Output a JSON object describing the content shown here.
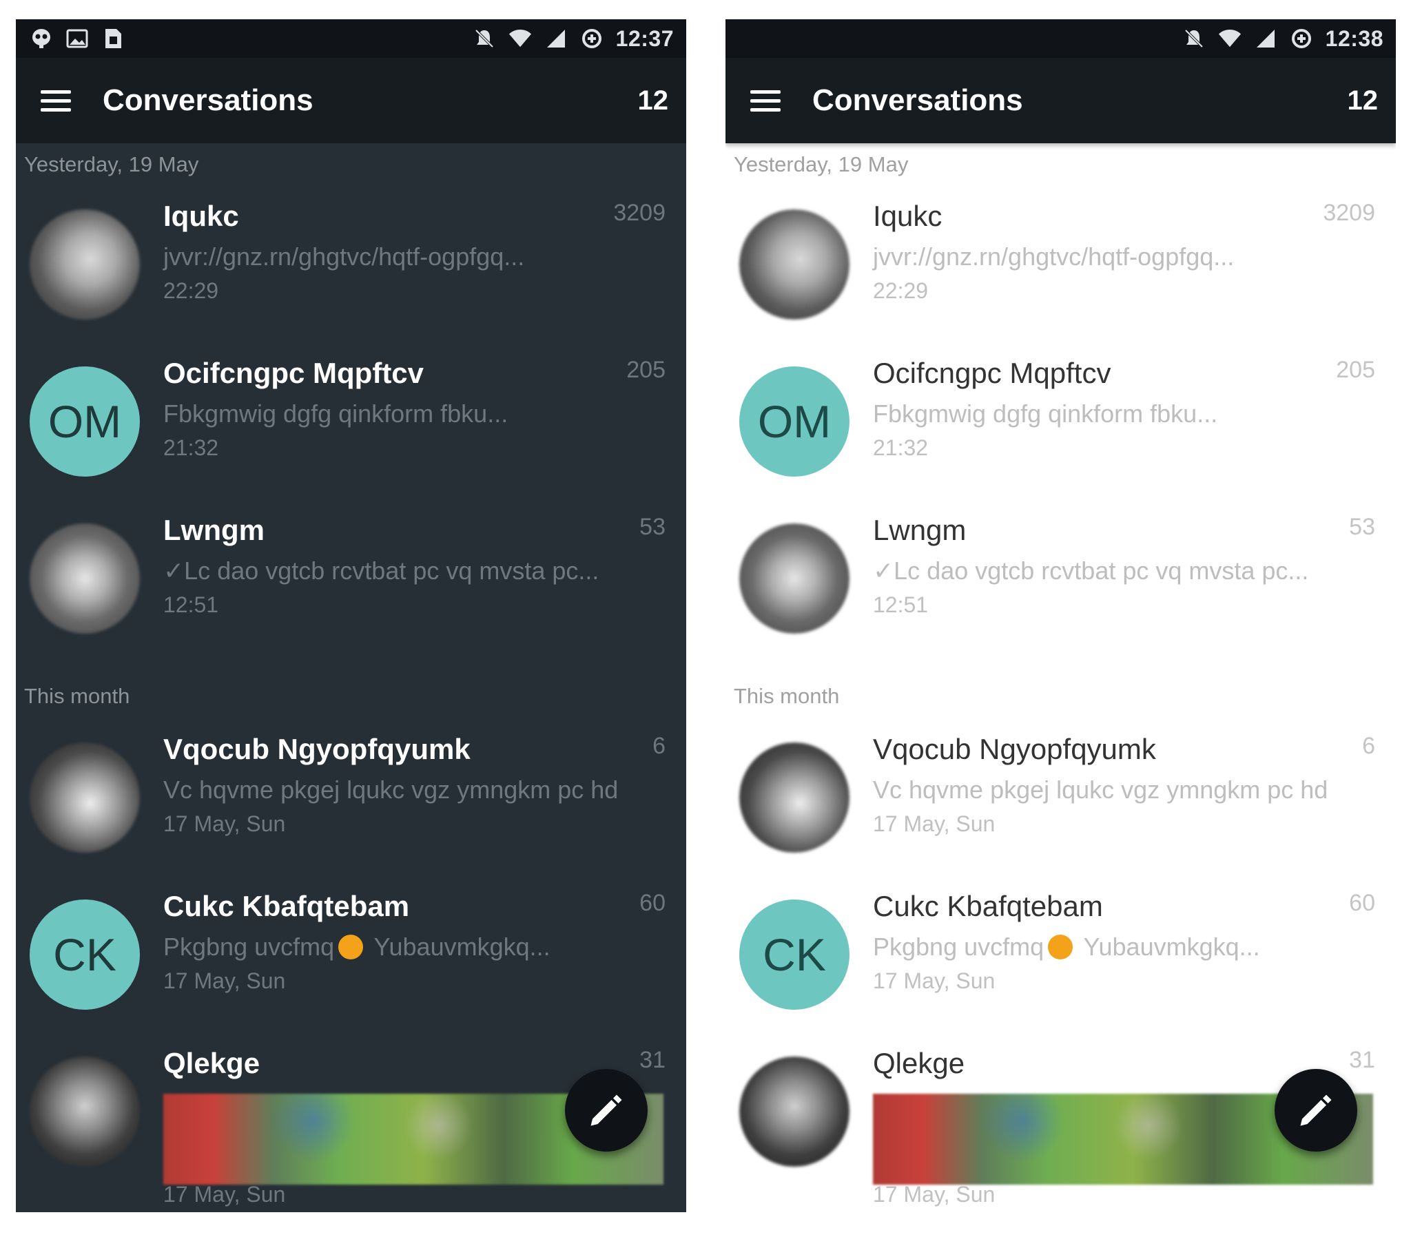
{
  "screens": [
    {
      "theme": "dark",
      "status_bar": {
        "left_icons": [
          "alien-icon",
          "image-icon",
          "sim-icon"
        ],
        "right_icons": [
          "notifications-off-icon",
          "wifi-icon",
          "signal-icon",
          "data-saver-icon"
        ],
        "time": "12:37"
      },
      "app_bar": {
        "title": "Conversations",
        "count": "12"
      },
      "sections": [
        {
          "header": "Yesterday, 19 May",
          "conversations": [
            {
              "name": "Iqukc",
              "count": "3209",
              "preview": "jvvr://gnz.rn/ghgtvc/hqtf-ogpfgq...",
              "time": "22:29",
              "avatar": "photo"
            },
            {
              "name": "Ocifcngpc Mqpftcv",
              "count": "205",
              "preview": "Fbkgmwig dgfg qinkform fbku...",
              "time": "21:32",
              "avatar": "initials",
              "initials": "OM"
            },
            {
              "name": "Lwngm",
              "count": "53",
              "preview": "✓Lc dao vgtcb rcvtbat pc vq mvsta pc...",
              "time": "12:51",
              "avatar": "photo"
            }
          ]
        },
        {
          "header": "This month",
          "conversations": [
            {
              "name": "Vqocub Ngyopfqyumk",
              "count": "6",
              "preview": "Vc hqvme pkgej lqukc vgz ymngkm pc hd",
              "time": "17 May, Sun",
              "avatar": "photo"
            },
            {
              "name": "Cukc Kbafqtebam",
              "count": "60",
              "preview_before": "Pkgbng uvcfmq",
              "preview_after": " Yubauvmkgkq...",
              "time": "17 May, Sun",
              "avatar": "initials",
              "initials": "CK"
            },
            {
              "name": "Qlekge",
              "count": "31",
              "time": "17 May, Sun",
              "avatar": "photo",
              "media": true
            }
          ]
        }
      ],
      "fab_icon": "pencil-icon"
    },
    {
      "theme": "light",
      "status_bar": {
        "right_icons": [
          "notifications-off-icon",
          "wifi-icon",
          "signal-icon",
          "data-saver-icon"
        ],
        "time": "12:38"
      },
      "app_bar": {
        "title": "Conversations",
        "count": "12"
      },
      "sections": [
        {
          "header": "Yesterday, 19 May",
          "conversations": [
            {
              "name": "Iqukc",
              "count": "3209",
              "preview": "jvvr://gnz.rn/ghgtvc/hqtf-ogpfgq...",
              "time": "22:29",
              "avatar": "photo"
            },
            {
              "name": "Ocifcngpc Mqpftcv",
              "count": "205",
              "preview": "Fbkgmwig dgfg qinkform fbku...",
              "time": "21:32",
              "avatar": "initials",
              "initials": "OM"
            },
            {
              "name": "Lwngm",
              "count": "53",
              "preview": "✓Lc dao vgtcb rcvtbat pc vq mvsta pc...",
              "time": "12:51",
              "avatar": "photo"
            }
          ]
        },
        {
          "header": "This month",
          "conversations": [
            {
              "name": "Vqocub Ngyopfqyumk",
              "count": "6",
              "preview": "Vc hqvme pkgej lqukc vgz ymngkm pc hd",
              "time": "17 May, Sun",
              "avatar": "photo"
            },
            {
              "name": "Cukc Kbafqtebam",
              "count": "60",
              "preview_before": "Pkgbng uvcfmq",
              "preview_after": " Yubauvmkgkq...",
              "time": "17 May, Sun",
              "avatar": "initials",
              "initials": "CK"
            },
            {
              "name": "Qlekge",
              "count": "31",
              "time": "17 May, Sun",
              "avatar": "photo",
              "media": true
            }
          ]
        }
      ],
      "fab_icon": "pencil-icon"
    }
  ],
  "colors": {
    "dark_background": "#262f36",
    "app_bar": "#171c21",
    "status_bar": "#101418",
    "initials_avatar": "#6ec6c0",
    "fab": "#0f1317",
    "emoji": "#f4a21a"
  }
}
